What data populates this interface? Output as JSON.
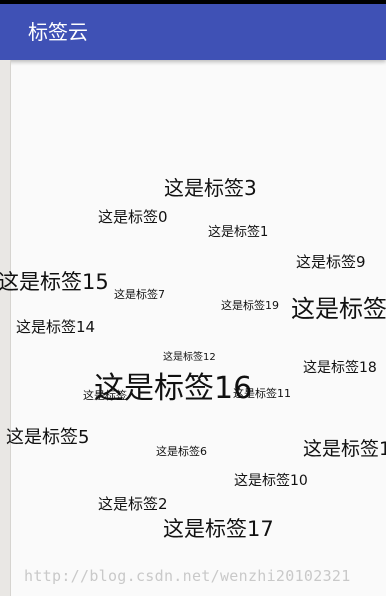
{
  "app": {
    "title": "标签云"
  },
  "tags": [
    {
      "text": "这是标签3"
    },
    {
      "text": "这是标签0"
    },
    {
      "text": "这是标签1"
    },
    {
      "text": "这是标签9"
    },
    {
      "text": "这是标签15"
    },
    {
      "text": "这是标签7"
    },
    {
      "text": "这是标签19"
    },
    {
      "text": "这是标签"
    },
    {
      "text": "这是标签14"
    },
    {
      "text": "这是标签12"
    },
    {
      "text": "这是标签18"
    },
    {
      "text": "这是标签16"
    },
    {
      "text": "这是标签"
    },
    {
      "text": "这是标签11"
    },
    {
      "text": "这是标签5"
    },
    {
      "text": "这是标签6"
    },
    {
      "text": "这是标签1"
    },
    {
      "text": "这是标签10"
    },
    {
      "text": "这是标签2"
    },
    {
      "text": "这是标签17"
    }
  ],
  "watermark": "http://blog.csdn.net/wenzhi20102321"
}
